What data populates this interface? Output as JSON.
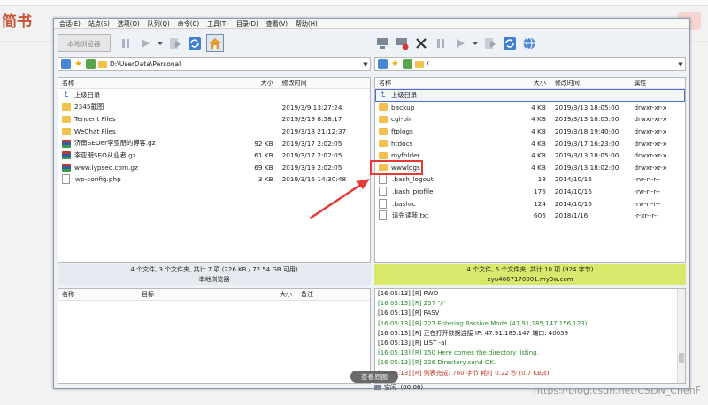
{
  "background": {
    "title": "简书",
    "watermark": "https://blog.csdn.net/CSDN_ChenF"
  },
  "menubar": [
    "会话(E)",
    "站点(S)",
    "选项(O)",
    "队列(Q)",
    "命令(C)",
    "工具(T)",
    "目录(D)",
    "查看(V)",
    "帮助(H)"
  ],
  "left": {
    "toolbar_button": "本地浏览器",
    "path": "D:\\UserData\\Personal",
    "columns": {
      "name": "名称",
      "size": "大小",
      "modified": "修改时间"
    },
    "rows": [
      {
        "icon": "up",
        "name": "上级目录",
        "size": "",
        "modified": ""
      },
      {
        "icon": "folder",
        "name": "2345截图",
        "size": "",
        "modified": "2019/3/9 13:27:24"
      },
      {
        "icon": "folder",
        "name": "Tencent Files",
        "size": "",
        "modified": "2019/3/19 8:58:17"
      },
      {
        "icon": "folder",
        "name": "WeChat Files",
        "size": "",
        "modified": "2019/3/18 21:12:37"
      },
      {
        "icon": "archive",
        "name": "济南SEOer李亚朋的博客.gz",
        "size": "92 KB",
        "modified": "2019/3/17 2:02:05"
      },
      {
        "icon": "archive",
        "name": "李亚朋SEO从业者.gz",
        "size": "61 KB",
        "modified": "2019/3/17 2:02:05"
      },
      {
        "icon": "archive",
        "name": "www.lypseo.com.gz",
        "size": "69 KB",
        "modified": "2019/3/19 2:02:05"
      },
      {
        "icon": "doc",
        "name": "wp-config.php",
        "size": "3 KB",
        "modified": "2019/3/16 14:30:48"
      }
    ],
    "status_line1": "4 个文件, 3 个文件夹, 共计 7 项 (226 KB / 72.54 GB 可用)",
    "status_line2": "本地浏览器",
    "queue_columns": {
      "name": "名称",
      "target": "目标",
      "size": "大小",
      "note": "备注"
    }
  },
  "right": {
    "path": "/",
    "columns": {
      "name": "名称",
      "size": "大小",
      "modified": "修改时间",
      "attr": "属性"
    },
    "rows": [
      {
        "icon": "up",
        "name": "上级目录",
        "size": "",
        "modified": "",
        "attr": ""
      },
      {
        "icon": "folder",
        "name": "backup",
        "size": "4 KB",
        "modified": "2019/3/13 18:05:00",
        "attr": "drwxr-xr-x"
      },
      {
        "icon": "folder",
        "name": "cgi-bin",
        "size": "4 KB",
        "modified": "2019/3/13 18:05:00",
        "attr": "drwxr-xr-x"
      },
      {
        "icon": "folder",
        "name": "ftplogs",
        "size": "4 KB",
        "modified": "2019/3/18 19:40:00",
        "attr": "drwxr-xr-x"
      },
      {
        "icon": "folder",
        "name": "htdocs",
        "size": "4 KB",
        "modified": "2019/3/17 16:23:00",
        "attr": "drwxr-xr-x"
      },
      {
        "icon": "folder",
        "name": "myfolder",
        "size": "4 KB",
        "modified": "2019/3/13 18:05:00",
        "attr": "drwxr-xr-x"
      },
      {
        "icon": "folder",
        "name": "wwwlogs",
        "size": "4 KB",
        "modified": "2019/3/13 18:02:00",
        "attr": "drwxr-xr-x"
      },
      {
        "icon": "doc",
        "name": ".bash_logout",
        "size": "18",
        "modified": "2014/10/16",
        "attr": "-rw-r--r--"
      },
      {
        "icon": "doc",
        "name": ".bash_profile",
        "size": "176",
        "modified": "2014/10/16",
        "attr": "-rw-r--r--"
      },
      {
        "icon": "doc",
        "name": ".bashrc",
        "size": "124",
        "modified": "2014/10/16",
        "attr": "-rw-r--r--"
      },
      {
        "icon": "doc",
        "name": "请先读我.txt",
        "size": "606",
        "modified": "2018/1/16",
        "attr": "-r-xr--r--"
      }
    ],
    "status_line1": "4 个文件, 6 个文件夹, 共计 10 项 (924 字节)",
    "status_line2": "xyu4067170001.my3w.com",
    "log": [
      {
        "text": "[16:05:13] [R] PWD",
        "color": "#222222"
      },
      {
        "text": "[16:05:13] [R] 257 \"/\"",
        "color": "#2e8b2e"
      },
      {
        "text": "[16:05:13] [R] PASV",
        "color": "#222222"
      },
      {
        "text": "[16:05:13] [R] 227 Entering Passive Mode (47,91,185,147,156,123).",
        "color": "#2e8b2e"
      },
      {
        "text": "[16:05:13] [R] 正在打开数据连接 IP: 47.91.185.147 端口: 40059",
        "color": "#222222"
      },
      {
        "text": "[16:05:13] [R] LIST -al",
        "color": "#222222"
      },
      {
        "text": "[16:05:13] [R] 150 Here comes the directory listing.",
        "color": "#2e8b2e"
      },
      {
        "text": "[16:05:13] [R] 226 Directory send OK.",
        "color": "#2e8b2e"
      },
      {
        "text": "[16:05:13] [R] 列表完成: 760 字节 耗时 0.22 秒 (0.7 KB/s)",
        "color": "#c0392b"
      }
    ],
    "bottom_status": "空闲. (00:06)"
  },
  "overlay": {
    "view_image": "查看原图"
  }
}
